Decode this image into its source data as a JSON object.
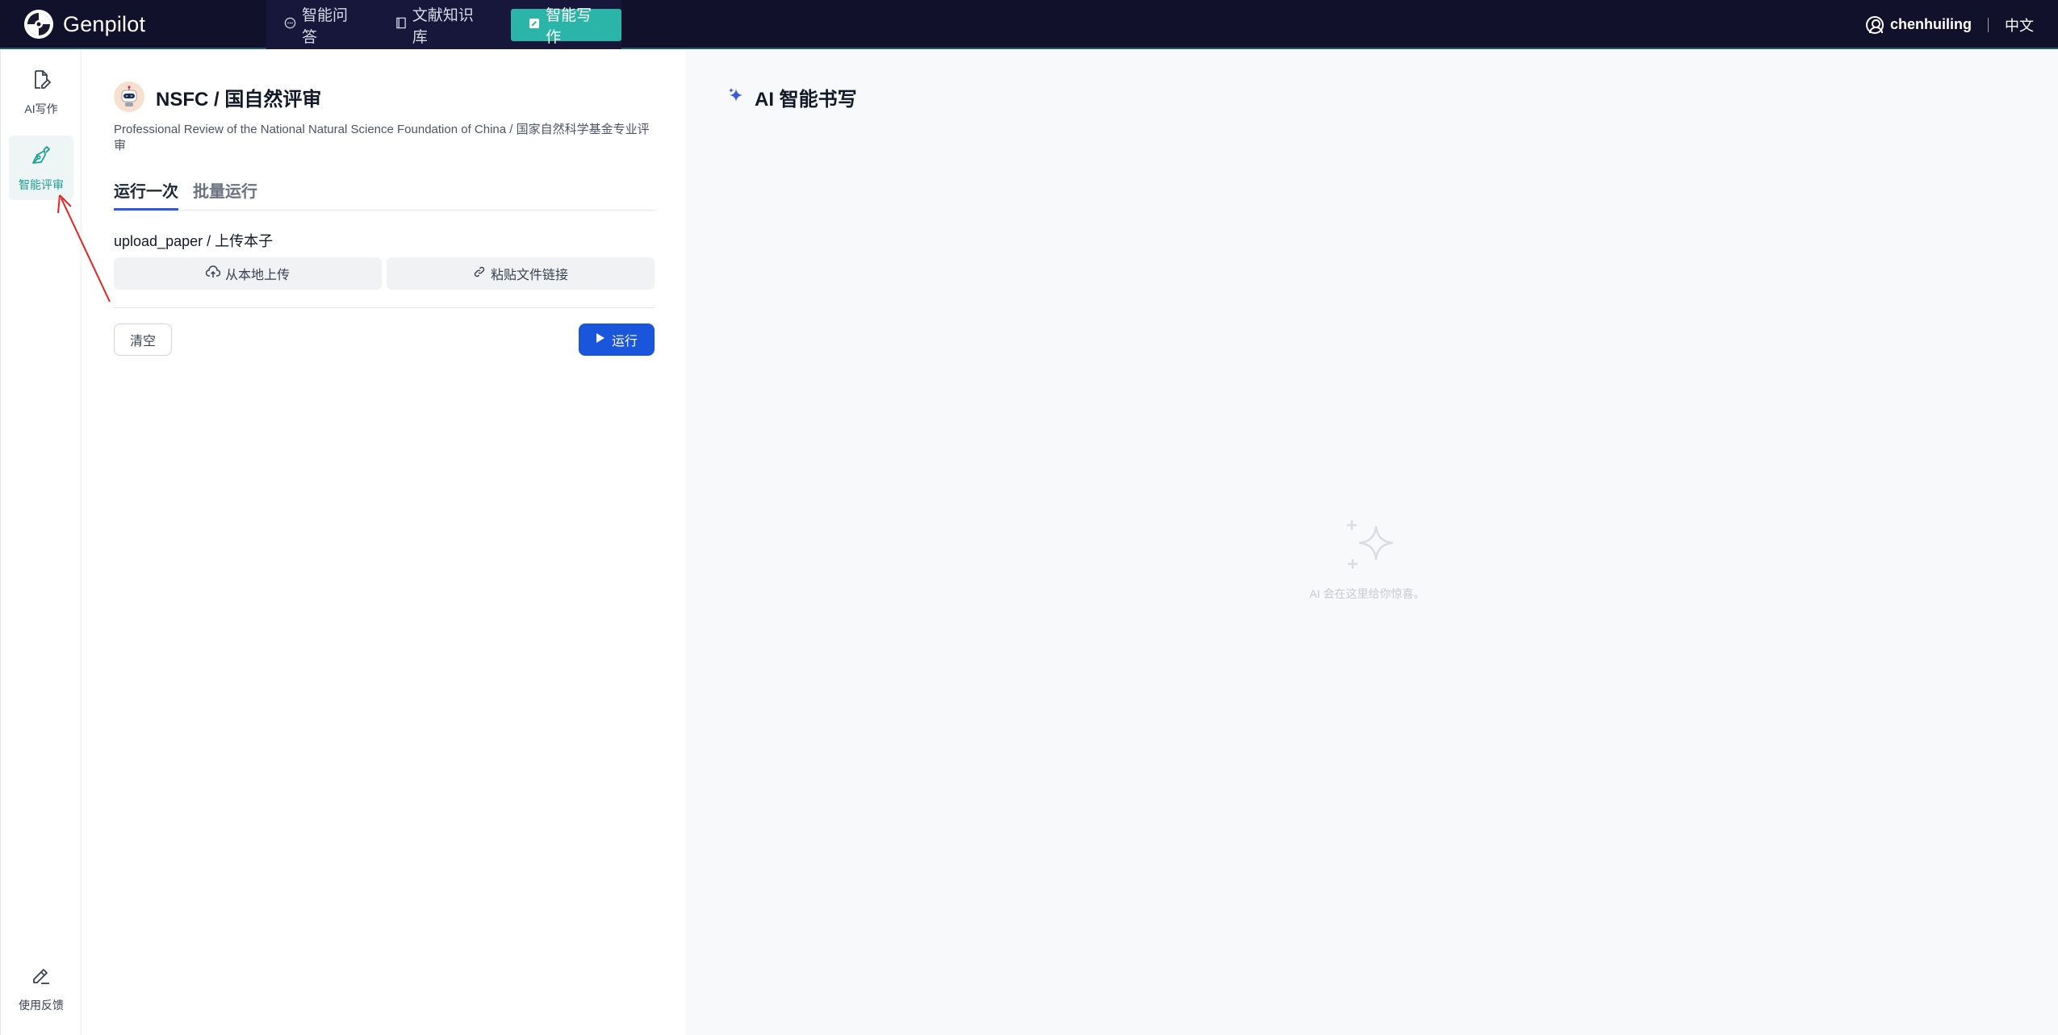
{
  "topbar": {
    "brand": "Genpilot",
    "nav": [
      {
        "label": "智能问答",
        "icon": "chat-icon"
      },
      {
        "label": "文献知识库",
        "icon": "book-icon"
      },
      {
        "label": "智能写作",
        "icon": "edit-icon",
        "active": true
      }
    ],
    "user": "chenhuiling",
    "language": "中文"
  },
  "rail": {
    "items": [
      {
        "label": "AI写作",
        "icon": "document-edit-icon"
      },
      {
        "label": "智能评审",
        "icon": "pen-tool-icon",
        "active": true
      }
    ],
    "feedback": "使用反馈"
  },
  "app": {
    "title": "NSFC / 国自然评审",
    "description": "Professional Review of the National Natural Science Foundation of China / 国家自然科学基金专业评审",
    "tabs": [
      "运行一次",
      "批量运行"
    ],
    "field_label": "upload_paper / 上传本子",
    "upload_local": "从本地上传",
    "paste_link": "粘贴文件链接",
    "clear": "清空",
    "run": "运行"
  },
  "output": {
    "title": "AI 智能书写",
    "empty_text": "AI 会在这里给你惊喜。"
  },
  "colors": {
    "topbar_bg": "#12112c",
    "accent_teal": "#2bb5a8",
    "primary_blue": "#1a56db",
    "annotation_red": "#e02424"
  }
}
